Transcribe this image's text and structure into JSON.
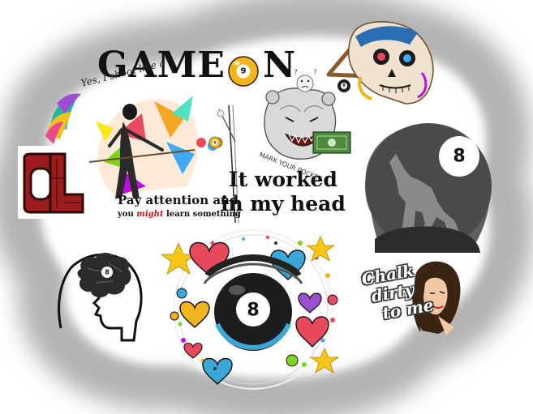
{
  "stickers": {
    "game_on": {
      "part1": "GAME",
      "part2": "N",
      "ball_number": "9"
    },
    "yes_i_shoot": "Yes, I shoot like a",
    "pay_attention": {
      "line1": "Pay attention and",
      "line2a": "you",
      "line2b": "might",
      "line2c": "learn something"
    },
    "it_worked": {
      "line1": "It worked",
      "line2": "in my head"
    },
    "mark_pocket": "MARK YOUR POCKET",
    "eight_ball_wolf": {
      "ball_number": "8"
    },
    "heart_eight_ball": {
      "ball_number": "8"
    },
    "brain_head": {
      "ball_number": "8"
    },
    "small_ball": {
      "ball_number": "9"
    },
    "rack_ball": {
      "ball_number": "8"
    },
    "chalk": {
      "line1": "Chalk",
      "line2": "dirty",
      "line3": "to me"
    },
    "lol_fragment": "OL"
  },
  "colors": {
    "background": "#ffffff",
    "vignette": "#9a9a9a",
    "ball_black": "#1d1d1f",
    "nine_ball_yellow": "#f3b51c",
    "wolf_gray": "#707070",
    "lol_red": "#9c1c1c",
    "heart_red": "#e64a5b",
    "heart_blue": "#3aa7d6",
    "star_yellow": "#f5c518"
  }
}
